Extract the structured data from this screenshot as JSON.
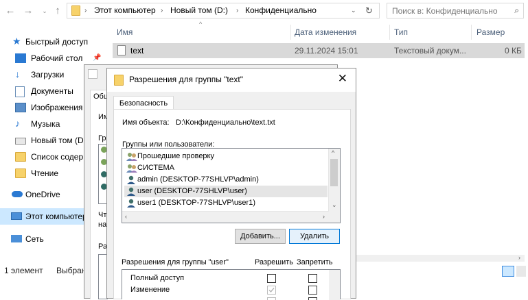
{
  "explorer": {
    "breadcrumb": [
      "Этот компьютер",
      "Новый том (D:)",
      "Конфиденциально"
    ],
    "search_placeholder": "Поиск в: Конфиденциально",
    "columns": {
      "name": "Имя",
      "date": "Дата изменения",
      "type": "Тип",
      "size": "Размер"
    },
    "files": [
      {
        "name": "text",
        "date": "29.11.2024 15:01",
        "type": "Текстовый докум...",
        "size": "0 КБ"
      }
    ],
    "nav": {
      "quick_access": "Быстрый доступ",
      "desktop": "Рабочий стол",
      "downloads": "Загрузки",
      "documents": "Документы",
      "pictures": "Изображения",
      "music": "Музыка",
      "new_volume": "Новый том (D",
      "list": "Список содер",
      "reading": "Чтение",
      "onedrive": "OneDrive",
      "this_pc": "Этот компьютер",
      "network": "Сеть"
    },
    "status": {
      "count": "1 элемент",
      "selected": "Выбран"
    }
  },
  "props_window": {
    "tab_general": "Общ",
    "label_i": "Им",
    "label_g": "Гр",
    "label_cht": "Чт",
    "label_na": "на",
    "label_r": "Ра"
  },
  "dialog": {
    "title": "Разрешения для группы \"text\"",
    "tab": "Безопасность",
    "object_label": "Имя объекта:",
    "object_path": "D:\\Конфиденциально\\text.txt",
    "groups_label": "Группы или пользователи:",
    "users": [
      {
        "name": "Прошедшие проверку",
        "icon": "group-icon"
      },
      {
        "name": "СИСТЕМА",
        "icon": "group-icon"
      },
      {
        "name": "admin (DESKTOP-77SHLVP\\admin)",
        "icon": "user-icon"
      },
      {
        "name": "user (DESKTOP-77SHLVP\\user)",
        "icon": "user-icon",
        "selected": true
      },
      {
        "name": "user1 (DESKTOP-77SHLVP\\user1)",
        "icon": "user-icon"
      }
    ],
    "add_button": "Добавить...",
    "remove_button": "Удалить",
    "permissions_label": "Разрешения для группы \"user\"",
    "allow_label": "Разрешить",
    "deny_label": "Запретить",
    "permissions": [
      {
        "name": "Полный доступ",
        "allow": false,
        "allow_disabled": false,
        "deny": false
      },
      {
        "name": "Изменение",
        "allow": true,
        "allow_disabled": true,
        "deny": false
      }
    ]
  }
}
